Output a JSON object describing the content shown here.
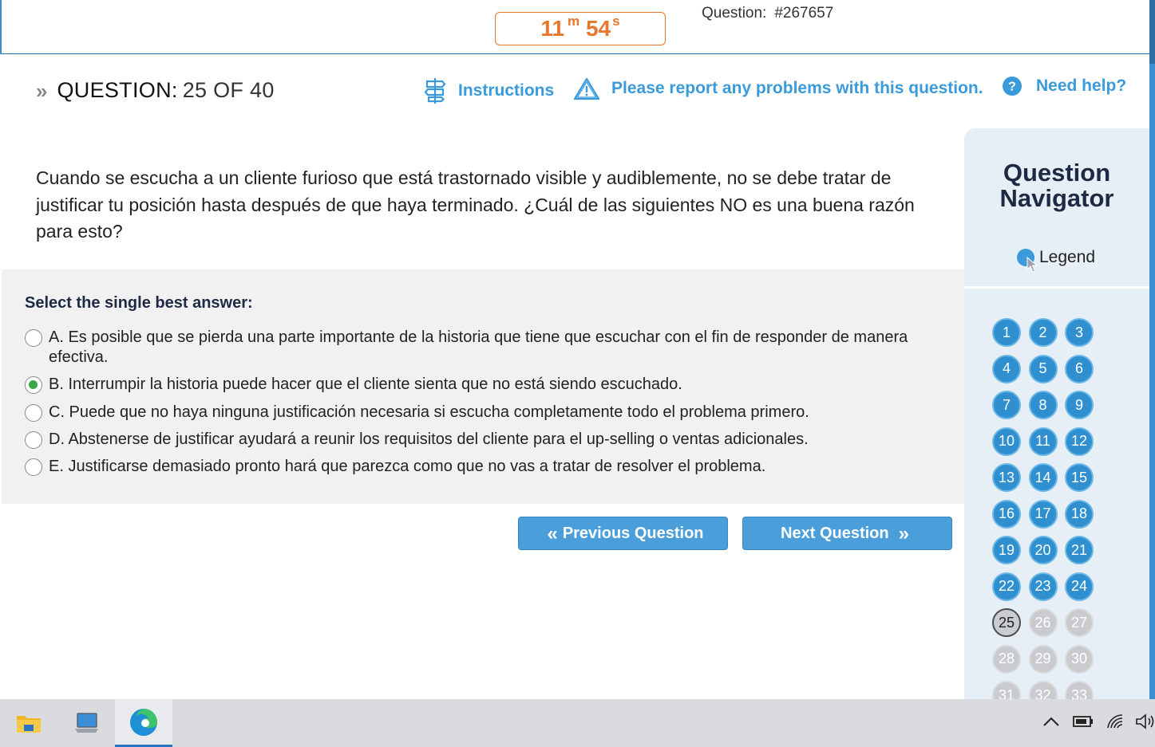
{
  "timer": {
    "minutes": "11",
    "min_unit": "m",
    "seconds": "54",
    "sec_unit": "s"
  },
  "question_id": {
    "label": "Question:",
    "value": "#267657"
  },
  "header": {
    "question_label": "QUESTION:",
    "question_count": "25 OF 40",
    "instructions": "Instructions",
    "report": "Please report any problems with this question.",
    "help": "Need help?"
  },
  "question": {
    "text": "Cuando se escucha a un cliente furioso que está trastornado visible y audiblemente, no se debe tratar de justificar tu posición hasta después de que haya terminado. ¿Cuál de las siguientes NO es una buena razón para esto?"
  },
  "answers": {
    "prompt": "Select the single best answer:",
    "selected": "B",
    "options": [
      {
        "text": "A. Es posible que se pierda una parte importante de la historia que tiene que escuchar con el fin de responder de manera efectiva."
      },
      {
        "text": "B. Interrumpir la historia puede hacer que el cliente sienta que no está siendo escuchado."
      },
      {
        "text": "C. Puede que no haya ninguna justificación necesaria si escucha completamente todo el problema primero."
      },
      {
        "text": "D. Abstenerse de justificar ayudará a reunir los requisitos del cliente para el up-selling o ventas adicionales."
      },
      {
        "text": "E. Justificarse demasiado pronto hará que parezca como que no vas a tratar de resolver el problema."
      }
    ]
  },
  "buttons": {
    "previous": "Previous Question",
    "next": "Next Question"
  },
  "navigator": {
    "title_line1": "Question",
    "title_line2": "Navigator",
    "legend": "Legend",
    "current": 25,
    "numbers": [
      "1",
      "2",
      "3",
      "4",
      "5",
      "6",
      "7",
      "8",
      "9",
      "10",
      "11",
      "12",
      "13",
      "14",
      "15",
      "16",
      "17",
      "18",
      "19",
      "20",
      "21",
      "22",
      "23",
      "24",
      "25",
      "26",
      "27",
      "28",
      "29",
      "30",
      "31",
      "32",
      "33"
    ]
  },
  "colors": {
    "accent": "#3b9ad9",
    "timer": "#e8772e",
    "selected_radio": "#3aa84a",
    "navigator_bg": "#e6eef6"
  },
  "taskbar": {
    "apps": [
      "file-explorer-icon",
      "this-pc-icon",
      "edge-icon"
    ],
    "tray": [
      "chevron-up-icon",
      "battery-icon",
      "wifi-icon",
      "volume-icon"
    ]
  }
}
